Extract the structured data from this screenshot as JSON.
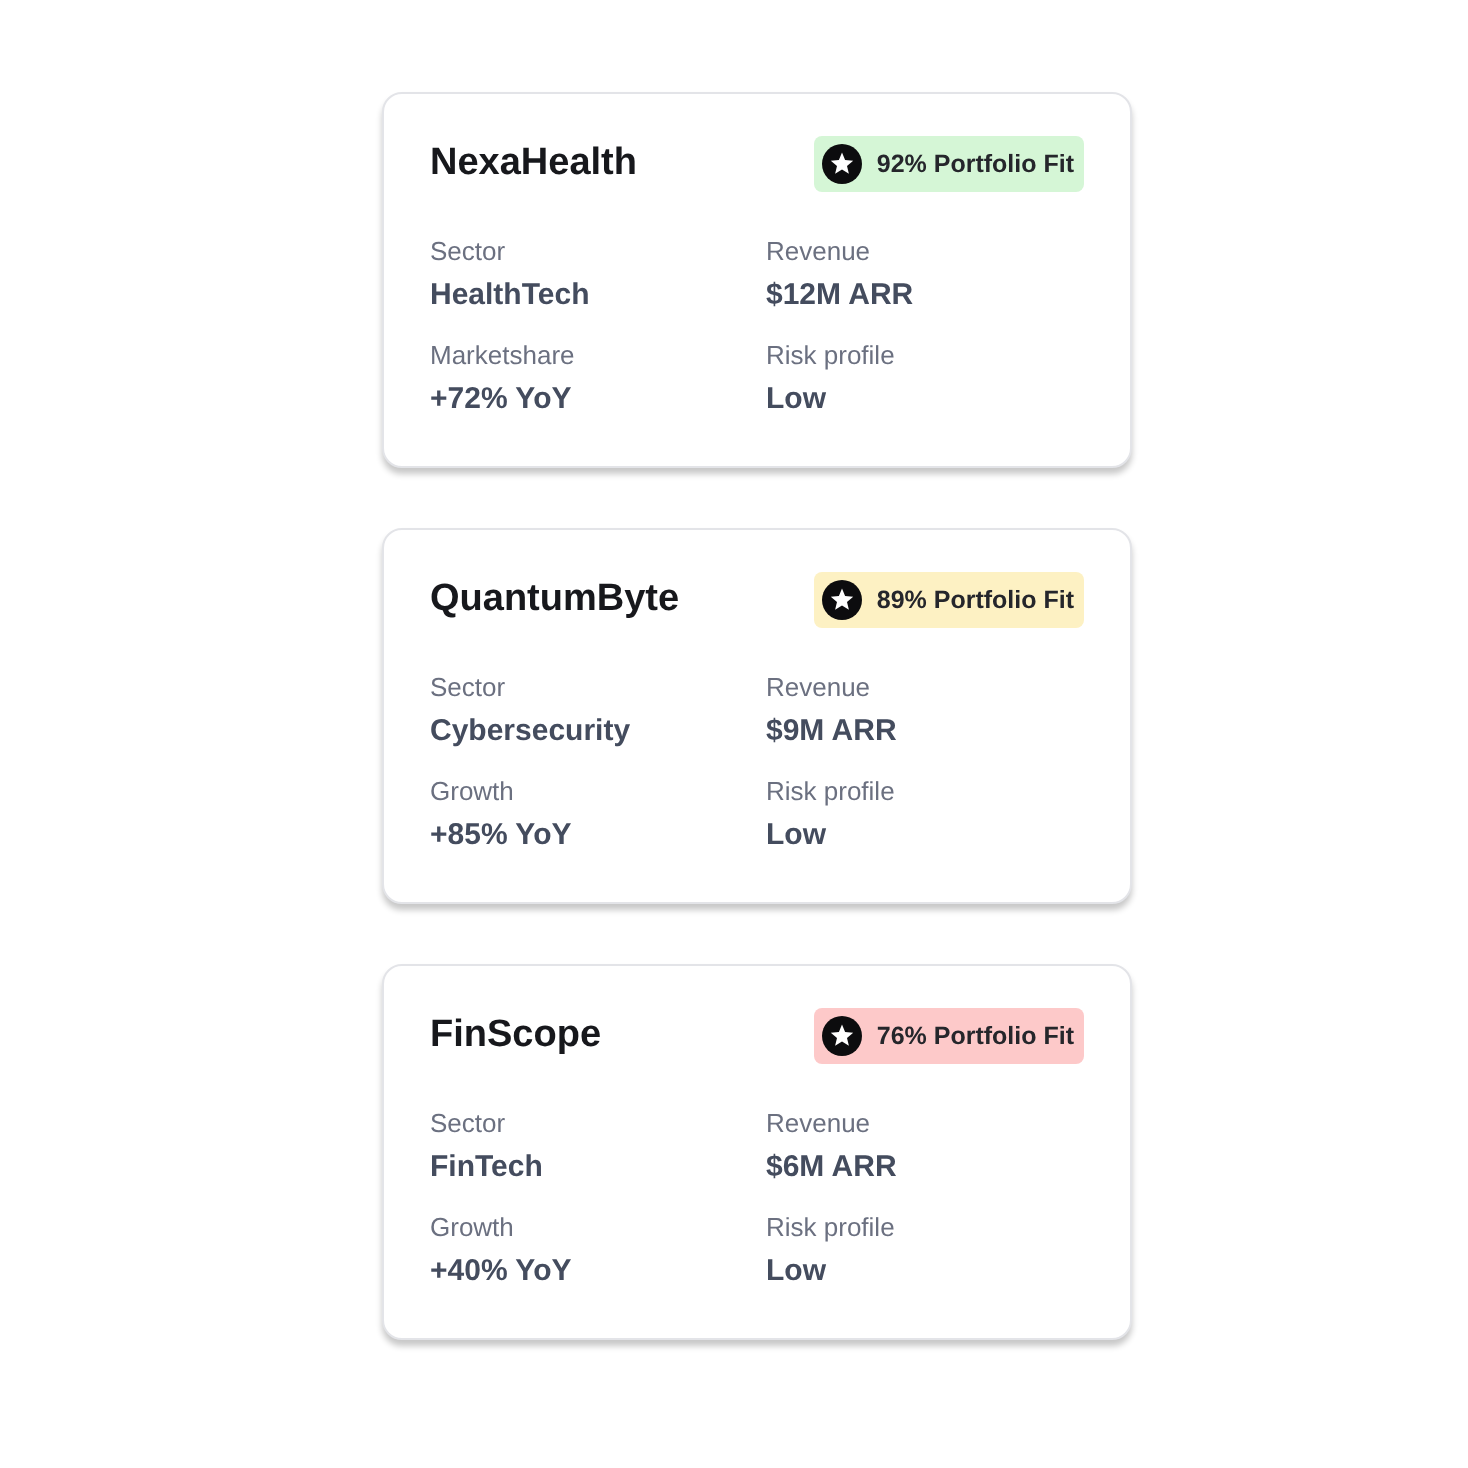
{
  "cards": [
    {
      "name": "NexaHealth",
      "badge": {
        "text": "92% Portfolio Fit",
        "color": "#d5f6d6"
      },
      "fields": [
        {
          "label": "Sector",
          "value": "HealthTech"
        },
        {
          "label": "Revenue",
          "value": "$12M ARR"
        },
        {
          "label": "Marketshare",
          "value": "+72% YoY"
        },
        {
          "label": "Risk profile",
          "value": "Low"
        }
      ]
    },
    {
      "name": "QuantumByte",
      "badge": {
        "text": "89% Portfolio Fit",
        "color": "#fdf1c3"
      },
      "fields": [
        {
          "label": "Sector",
          "value": "Cybersecurity"
        },
        {
          "label": "Revenue",
          "value": "$9M ARR"
        },
        {
          "label": "Growth",
          "value": "+85% YoY"
        },
        {
          "label": "Risk profile",
          "value": "Low"
        }
      ]
    },
    {
      "name": "FinScope",
      "badge": {
        "text": "76% Portfolio Fit",
        "color": "#fdc9c9"
      },
      "fields": [
        {
          "label": "Sector",
          "value": "FinTech"
        },
        {
          "label": "Revenue",
          "value": "$6M ARR"
        },
        {
          "label": "Growth",
          "value": "+40% YoY"
        },
        {
          "label": "Risk profile",
          "value": "Low"
        }
      ]
    }
  ]
}
